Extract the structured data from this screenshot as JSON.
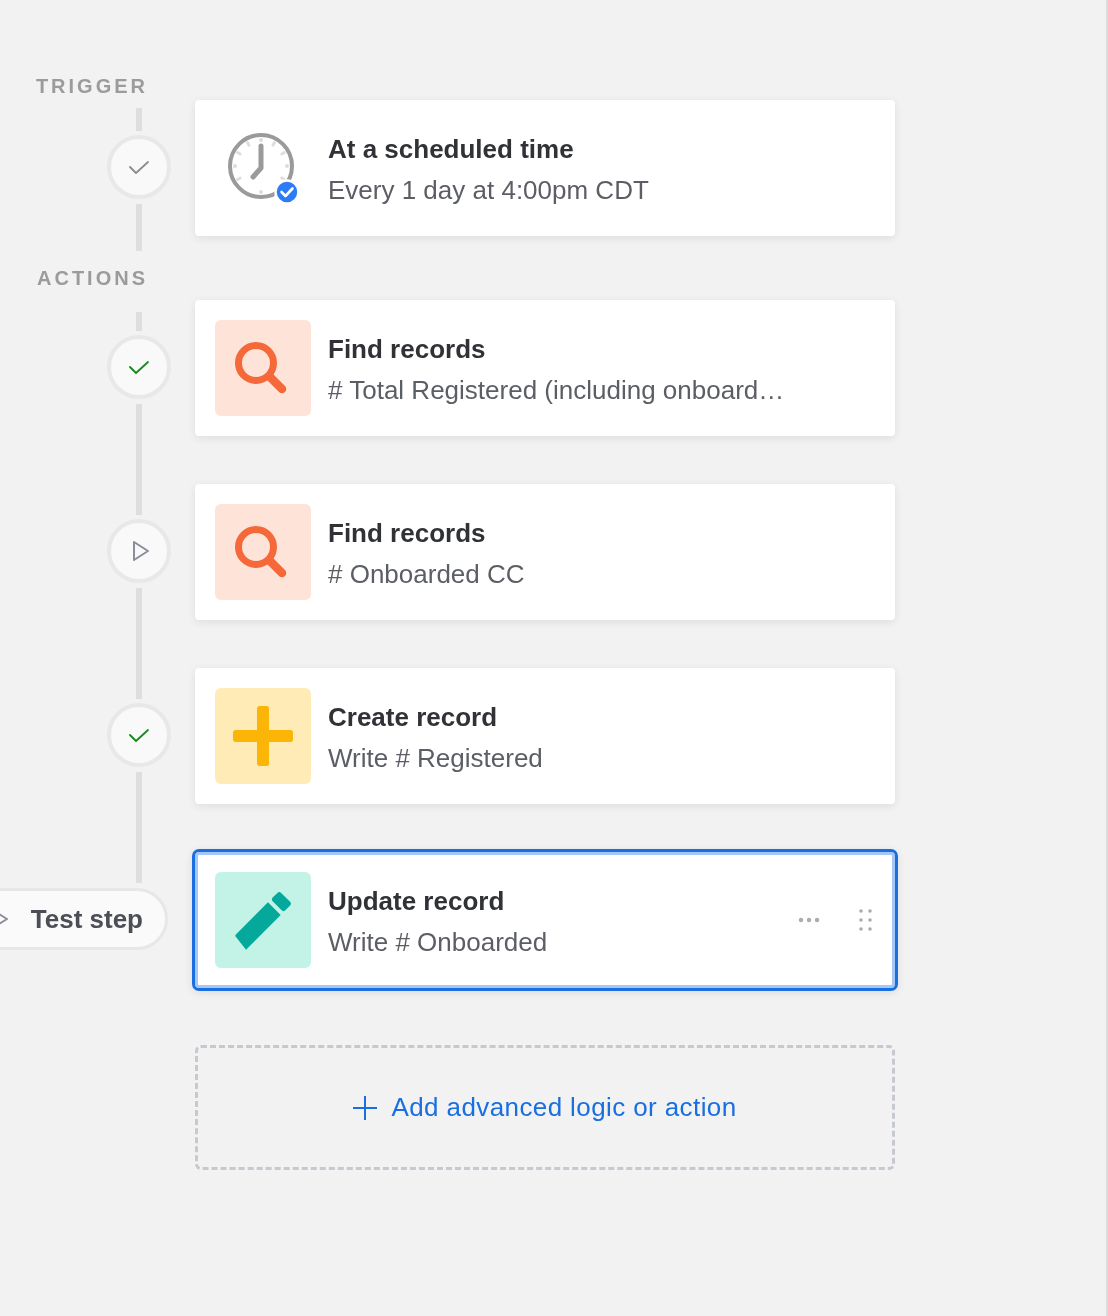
{
  "sections": [
    {
      "label": "TRIGGER",
      "steps": [
        {
          "kind": "clock",
          "title": "At a scheduled time",
          "subtitle": "Every 1 day at 4:00pm CDT",
          "marker": {
            "kind": "check",
            "color": "#8c8c8c"
          },
          "selected": false
        }
      ]
    },
    {
      "label": "ACTIONS",
      "steps": [
        {
          "kind": "search",
          "title": "Find records",
          "subtitle": "# Total Registered (including onboard…",
          "marker": {
            "kind": "check",
            "color": "#16891c"
          },
          "selected": false
        },
        {
          "kind": "search",
          "title": "Find records",
          "subtitle": "# Onboarded CC",
          "marker": {
            "kind": "play"
          },
          "selected": false
        },
        {
          "kind": "plus",
          "title": "Create record",
          "subtitle": "Write # Registered",
          "marker": {
            "kind": "check",
            "color": "#16891c"
          },
          "selected": false
        },
        {
          "kind": "pencil",
          "title": "Update record",
          "subtitle": "Write # Onboarded",
          "marker": {
            "kind": "button",
            "label": "Test step"
          },
          "selected": true
        }
      ]
    }
  ],
  "add_action": {
    "label": "Add advanced logic or action"
  }
}
